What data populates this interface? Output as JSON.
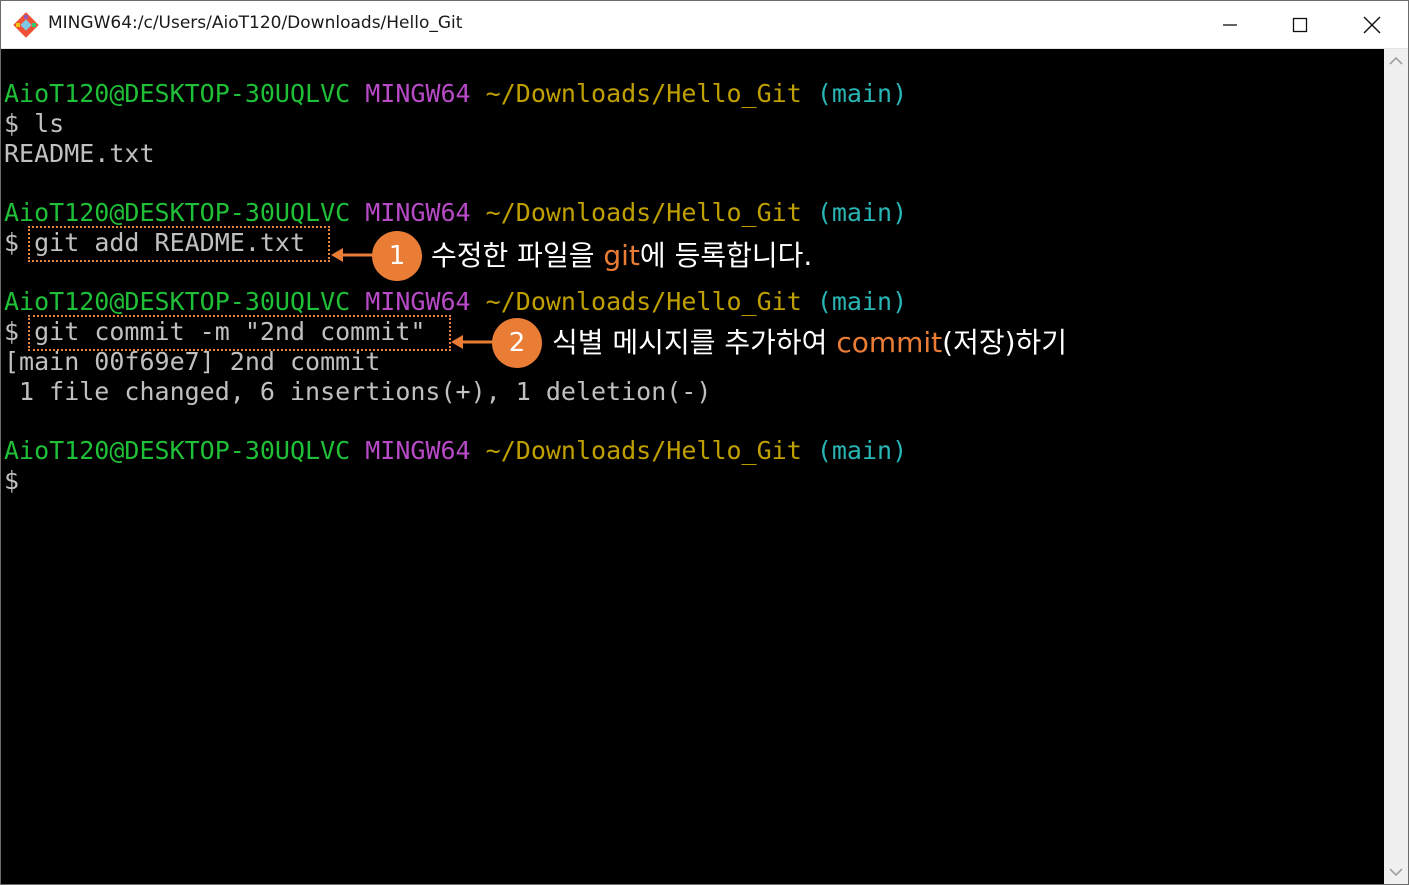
{
  "window": {
    "title": "MINGW64:/c/Users/AioT120/Downloads/Hello_Git",
    "icon": "git-diamond-icon",
    "controls": [
      "minimize-icon",
      "maximize-icon",
      "close-icon"
    ]
  },
  "prompt": {
    "user": "AioT120@DESKTOP-30UQLVC",
    "system": "MINGW64",
    "path": "~/Downloads/Hello_Git",
    "branch": "(main)"
  },
  "terminal": {
    "cmd1": "$ ls",
    "out1": "README.txt",
    "cmd2_prefix": "$ ",
    "cmd2": "git add README.txt",
    "cmd3_prefix": "$ ",
    "cmd3": "git commit -m \"2nd commit\"",
    "out3a": "[main 00f69e7] 2nd commit",
    "out3b": " 1 file changed, 6 insertions(+), 1 deletion(-)",
    "cmd4": "$"
  },
  "annotations": [
    {
      "number": "1",
      "text_before": "수정한 파일을 ",
      "accent": "git",
      "text_after": "에 등록합니다."
    },
    {
      "number": "2",
      "text_before": "식별 메시지를 추가하여 ",
      "accent": "commit",
      "text_after": "(저장)하기"
    }
  ],
  "colors": {
    "user": "#1fbf37",
    "system": "#b84ac8",
    "path": "#c0a000",
    "branch": "#2ab5b5",
    "accent": "#ea7d35"
  }
}
